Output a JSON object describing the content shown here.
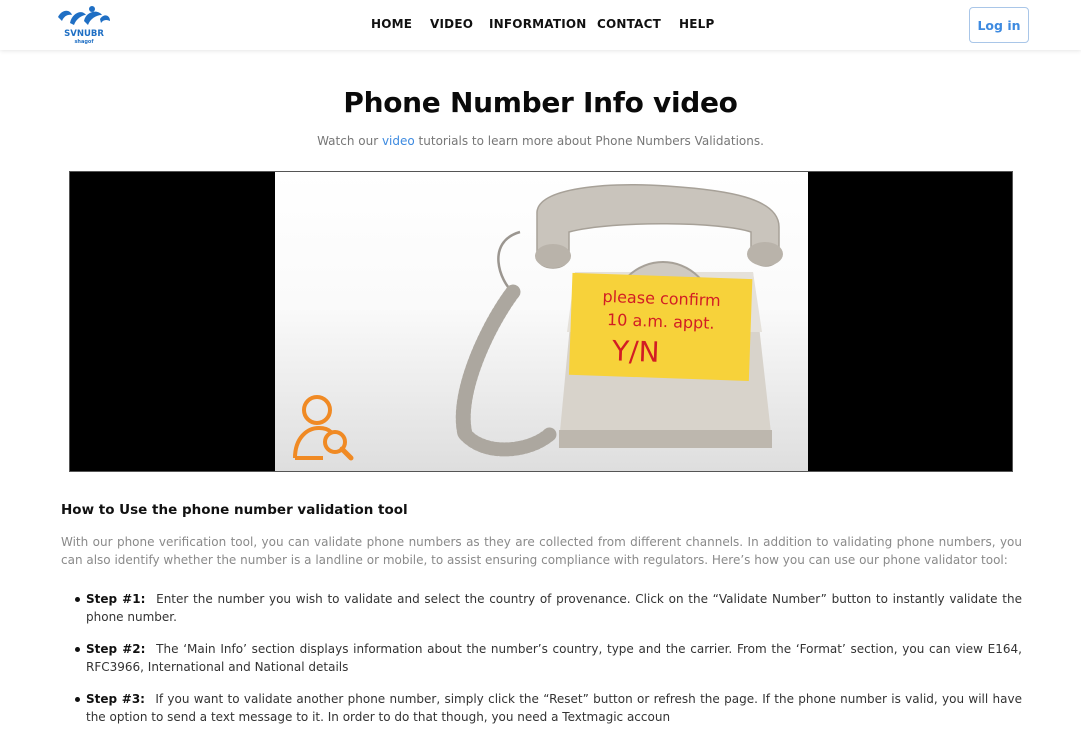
{
  "header": {
    "logo_text": "SVNUBR",
    "logo_subtext": "shagof",
    "nav": [
      {
        "label": "HOME"
      },
      {
        "label": "VIDEO"
      },
      {
        "label": "INFORMATION"
      },
      {
        "label": "CONTACT"
      },
      {
        "label": "HELP"
      }
    ],
    "login_label": "Log in"
  },
  "hero": {
    "title": "Phone Number Info video",
    "subtitle_before": "Watch our ",
    "subtitle_link": "video",
    "subtitle_after": " tutorials to learn more about Phone Numbers Validations."
  },
  "video": {
    "note_lines": [
      "please confirm",
      "10 a.m. appt.",
      "Y/N"
    ],
    "accent_color": "#f08a24"
  },
  "content": {
    "heading": "How to Use the phone number validation tool",
    "intro": "With our phone verification tool, you can validate phone numbers as they are collected from different channels. In addition to validating phone numbers, you can also identify whether the number is a landline or mobile, to assist ensuring compliance with regulators. Here’s how you can use our phone validator tool:",
    "steps": [
      {
        "label": "Step #1:",
        "text": "Enter the number you wish to validate and select the country of provenance. Click on the “Validate Number” button to instantly validate the phone number."
      },
      {
        "label": "Step #2:",
        "text": "The ‘Main Info’ section displays information about the number’s country, type and the carrier. From the ‘Format’ section, you can view E164, RFC3966, International and National details"
      },
      {
        "label": "Step #3:",
        "text": "If you want to validate another phone number, simply click the “Reset” button or refresh the page. If the phone number is valid, you will have the option to send a text message to it. In order to do that though, you need a Textmagic accoun"
      }
    ]
  },
  "colors": {
    "accent": "#3d8ae0",
    "logo_blue": "#1f6fc4"
  }
}
